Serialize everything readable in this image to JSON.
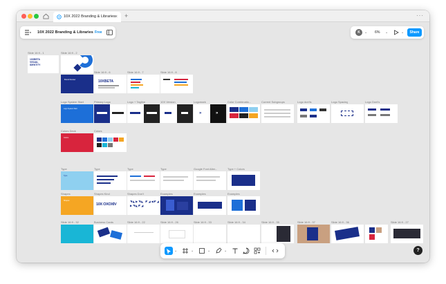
{
  "window": {
    "tab_title": "10X 2022 Branding & Libraries",
    "tab_close": "×",
    "new_tab": "+",
    "more": "···"
  },
  "toolbar": {
    "file_title": "10X 2022 Branding & Libraries",
    "plan_badge": "Free",
    "avatar_initial": "K",
    "zoom": "6%",
    "share_label": "Share"
  },
  "canvas": {
    "slide_labels": [
      "Slide 16:9 - 1",
      "Slide 16:9 - 2",
      "Slide 16:9 - 6",
      "Slide 16:9 - 7",
      "Slide 16:9 - 8",
      "Logo System Start",
      "Primary Logo",
      "Logo + Tagline",
      "10X Version",
      "Logomark",
      "Color Combinatio...",
      "Current Subgroups",
      "Logo don'ts",
      "Logo Spacing",
      "Logo Dont's",
      "Colors Deck",
      "Colors",
      "Type",
      "Type",
      "Type",
      "Type",
      "Google Font Alter...",
      "Type + Colors",
      "Shapes",
      "Shapes Kind",
      "Shapes Don't",
      "Examples",
      "Examples",
      "Examples",
      "Slide 16:9 - 32",
      "Business Cards",
      "Slide 16:9 - 22",
      "Slide 16:9 - 26",
      "Slide 16:9 - 33",
      "Slide 16:9 - 34",
      "Slide 16:9 - 35",
      "Slide 16:9 - 37",
      "Slide 16:9 - 36",
      "Slide 16:9 - 27"
    ],
    "slide_text": {
      "visual_identity": "10XBETA VISUAL IDENTITY",
      "brand_review": "Brand Review",
      "tenxbeta": "10XBETA",
      "logo_system": "Logo System Start",
      "type_head": "Type",
      "colors_head": "Colors",
      "shapes_head": "Shapes"
    }
  },
  "colors": {
    "accent": "#0d99ff",
    "brand_navy": "#1a2f8a",
    "brand_blue": "#1d6fd8",
    "brand_red": "#d8243d",
    "light_blue": "#8fd0f0",
    "yellow": "#f5a623",
    "cyan": "#19b6d6"
  },
  "help": "?"
}
